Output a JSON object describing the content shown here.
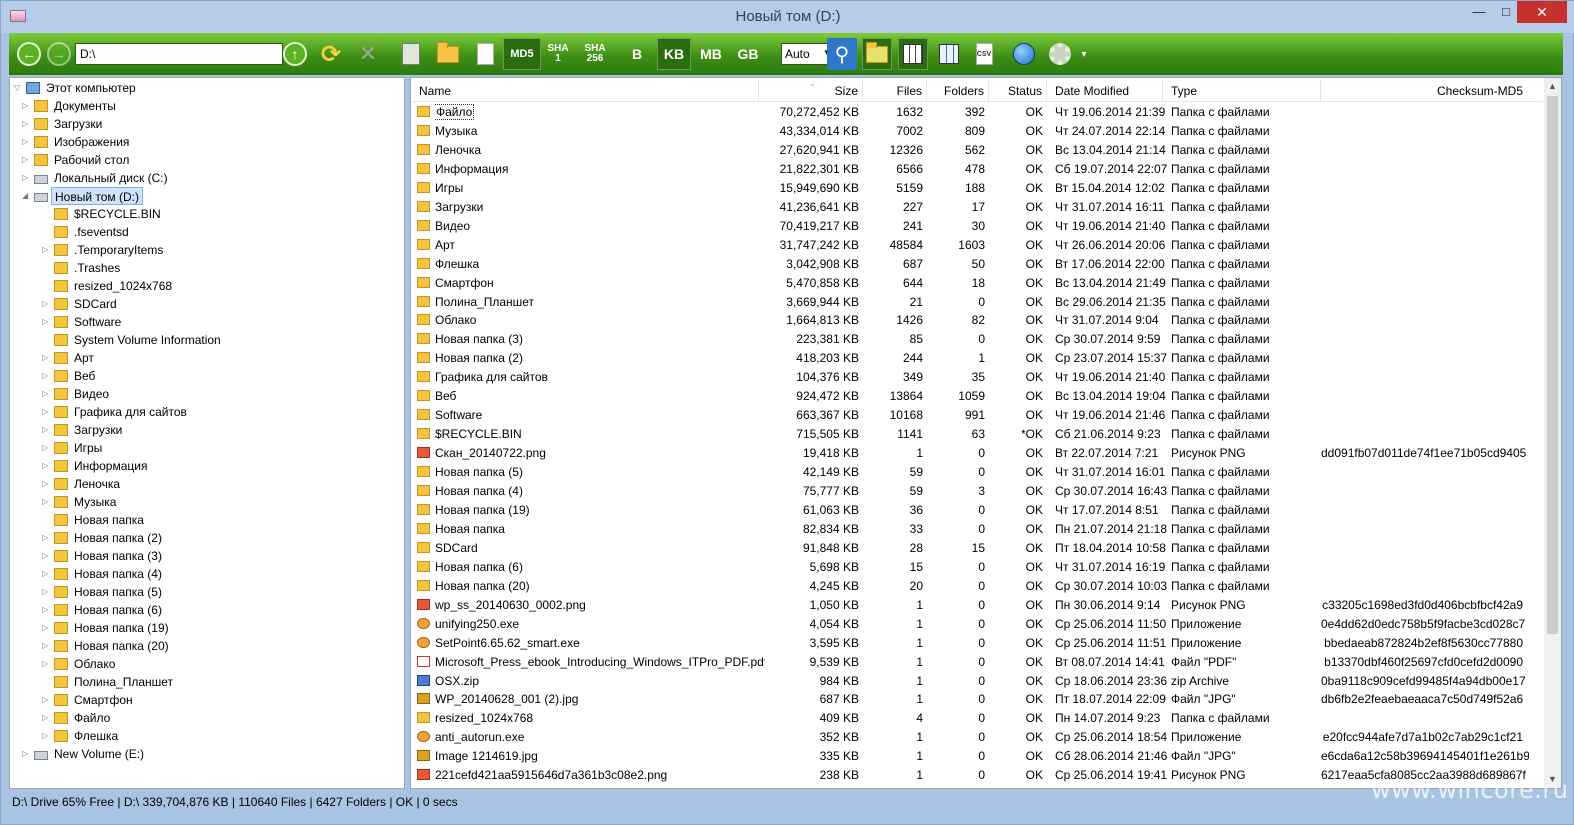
{
  "window": {
    "title": "Новый том (D:)",
    "minimize": "—",
    "maximize": "□",
    "close": "✕"
  },
  "toolbar": {
    "back": "←",
    "forward": "→",
    "path": "D:\\",
    "up": "↑",
    "refresh": "⟳",
    "stop": "✕",
    "md5": "MD5",
    "sha1": [
      "SHA",
      "1"
    ],
    "sha256": [
      "SHA",
      "256"
    ],
    "unit_b": "B",
    "unit_kb": "KB",
    "unit_mb": "MB",
    "unit_gb": "GB",
    "auto": "Auto",
    "csv": "CSV",
    "search": "⚲",
    "menu_arrow": "▾"
  },
  "tree": [
    {
      "label": "Этот компьютер",
      "level": 0,
      "expander": "▽",
      "icon": "pc"
    },
    {
      "label": "Документы",
      "level": 1,
      "expander": "▷",
      "icon": "folder"
    },
    {
      "label": "Загрузки",
      "level": 1,
      "expander": "▷",
      "icon": "folder"
    },
    {
      "label": "Изображения",
      "level": 1,
      "expander": "▷",
      "icon": "folder"
    },
    {
      "label": "Рабочий стол",
      "level": 1,
      "expander": "▷",
      "icon": "folder"
    },
    {
      "label": "Локальный диск (C:)",
      "level": 1,
      "expander": "▷",
      "icon": "drive"
    },
    {
      "label": "Новый том (D:)",
      "level": 1,
      "expander": "◢",
      "icon": "drive",
      "selected": true
    },
    {
      "label": "$RECYCLE.BIN",
      "level": 2,
      "expander": "",
      "icon": "folder"
    },
    {
      "label": ".fseventsd",
      "level": 2,
      "expander": "",
      "icon": "folder"
    },
    {
      "label": ".TemporaryItems",
      "level": 2,
      "expander": "▷",
      "icon": "folder"
    },
    {
      "label": ".Trashes",
      "level": 2,
      "expander": "",
      "icon": "folder"
    },
    {
      "label": "resized_1024x768",
      "level": 2,
      "expander": "",
      "icon": "folder"
    },
    {
      "label": "SDCard",
      "level": 2,
      "expander": "▷",
      "icon": "folder"
    },
    {
      "label": "Software",
      "level": 2,
      "expander": "▷",
      "icon": "folder"
    },
    {
      "label": "System Volume Information",
      "level": 2,
      "expander": "",
      "icon": "folder"
    },
    {
      "label": "Арт",
      "level": 2,
      "expander": "▷",
      "icon": "folder"
    },
    {
      "label": "Веб",
      "level": 2,
      "expander": "▷",
      "icon": "folder"
    },
    {
      "label": "Видео",
      "level": 2,
      "expander": "▷",
      "icon": "folder"
    },
    {
      "label": "Графика для сайтов",
      "level": 2,
      "expander": "▷",
      "icon": "folder"
    },
    {
      "label": "Загрузки",
      "level": 2,
      "expander": "▷",
      "icon": "folder"
    },
    {
      "label": "Игры",
      "level": 2,
      "expander": "▷",
      "icon": "folder"
    },
    {
      "label": "Информация",
      "level": 2,
      "expander": "▷",
      "icon": "folder"
    },
    {
      "label": "Леночка",
      "level": 2,
      "expander": "▷",
      "icon": "folder"
    },
    {
      "label": "Музыка",
      "level": 2,
      "expander": "▷",
      "icon": "folder"
    },
    {
      "label": "Новая папка",
      "level": 2,
      "expander": "",
      "icon": "folder"
    },
    {
      "label": "Новая папка (2)",
      "level": 2,
      "expander": "▷",
      "icon": "folder"
    },
    {
      "label": "Новая папка (3)",
      "level": 2,
      "expander": "▷",
      "icon": "folder"
    },
    {
      "label": "Новая папка (4)",
      "level": 2,
      "expander": "▷",
      "icon": "folder"
    },
    {
      "label": "Новая папка (5)",
      "level": 2,
      "expander": "▷",
      "icon": "folder"
    },
    {
      "label": "Новая папка (6)",
      "level": 2,
      "expander": "▷",
      "icon": "folder"
    },
    {
      "label": "Новая папка (19)",
      "level": 2,
      "expander": "▷",
      "icon": "folder"
    },
    {
      "label": "Новая папка (20)",
      "level": 2,
      "expander": "▷",
      "icon": "folder"
    },
    {
      "label": "Облако",
      "level": 2,
      "expander": "▷",
      "icon": "folder"
    },
    {
      "label": "Полина_Планшет",
      "level": 2,
      "expander": "",
      "icon": "folder"
    },
    {
      "label": "Смартфон",
      "level": 2,
      "expander": "▷",
      "icon": "folder"
    },
    {
      "label": "Файло",
      "level": 2,
      "expander": "▷",
      "icon": "folder"
    },
    {
      "label": "Флешка",
      "level": 2,
      "expander": "▷",
      "icon": "folder"
    },
    {
      "label": "New Volume (E:)",
      "level": 1,
      "expander": "▷",
      "icon": "drive"
    }
  ],
  "columns": {
    "name": "Name",
    "size": "Size",
    "files": "Files",
    "folders": "Folders",
    "status": "Status",
    "date": "Date Modified",
    "type": "Type",
    "checksum": "Checksum-MD5"
  },
  "files": [
    {
      "name": "Файло",
      "icon": "folder",
      "size": "70,272,452 KB",
      "files": "1632",
      "folders": "392",
      "status": "OK",
      "date": "Чт 19.06.2014 21:39",
      "type": "Папка с файлами",
      "md5": ""
    },
    {
      "name": "Музыка",
      "icon": "folder",
      "size": "43,334,014 KB",
      "files": "7002",
      "folders": "809",
      "status": "OK",
      "date": "Чт 24.07.2014 22:14",
      "type": "Папка с файлами",
      "md5": ""
    },
    {
      "name": "Леночка",
      "icon": "folder",
      "size": "27,620,941 KB",
      "files": "12326",
      "folders": "562",
      "status": "OK",
      "date": "Вс 13.04.2014 21:14",
      "type": "Папка с файлами",
      "md5": ""
    },
    {
      "name": "Информация",
      "icon": "folder",
      "size": "21,822,301 KB",
      "files": "6566",
      "folders": "478",
      "status": "OK",
      "date": "Сб 19.07.2014 22:07",
      "type": "Папка с файлами",
      "md5": ""
    },
    {
      "name": "Игры",
      "icon": "folder",
      "size": "15,949,690 KB",
      "files": "5159",
      "folders": "188",
      "status": "OK",
      "date": "Вт 15.04.2014 12:02",
      "type": "Папка с файлами",
      "md5": ""
    },
    {
      "name": "Загрузки",
      "icon": "folder",
      "size": "41,236,641 KB",
      "files": "227",
      "folders": "17",
      "status": "OK",
      "date": "Чт 31.07.2014 16:11",
      "type": "Папка с файлами",
      "md5": ""
    },
    {
      "name": "Видео",
      "icon": "folder",
      "size": "70,419,217 KB",
      "files": "241",
      "folders": "30",
      "status": "OK",
      "date": "Чт 19.06.2014 21:40",
      "type": "Папка с файлами",
      "md5": ""
    },
    {
      "name": "Арт",
      "icon": "folder",
      "size": "31,747,242 KB",
      "files": "48584",
      "folders": "1603",
      "status": "OK",
      "date": "Чт 26.06.2014 20:06",
      "type": "Папка с файлами",
      "md5": ""
    },
    {
      "name": "Флешка",
      "icon": "folder",
      "size": "3,042,908 KB",
      "files": "687",
      "folders": "50",
      "status": "OK",
      "date": "Вт 17.06.2014 22:00",
      "type": "Папка с файлами",
      "md5": ""
    },
    {
      "name": "Смартфон",
      "icon": "folder",
      "size": "5,470,858 KB",
      "files": "644",
      "folders": "18",
      "status": "OK",
      "date": "Вс 13.04.2014 21:49",
      "type": "Папка с файлами",
      "md5": ""
    },
    {
      "name": "Полина_Планшет",
      "icon": "folder",
      "size": "3,669,944 KB",
      "files": "21",
      "folders": "0",
      "status": "OK",
      "date": "Вс 29.06.2014 21:35",
      "type": "Папка с файлами",
      "md5": ""
    },
    {
      "name": "Облако",
      "icon": "folder",
      "size": "1,664,813 KB",
      "files": "1426",
      "folders": "82",
      "status": "OK",
      "date": "Чт 31.07.2014 9:04",
      "type": "Папка с файлами",
      "md5": ""
    },
    {
      "name": "Новая папка (3)",
      "icon": "folder",
      "size": "223,381 KB",
      "files": "85",
      "folders": "0",
      "status": "OK",
      "date": "Ср 30.07.2014 9:59",
      "type": "Папка с файлами",
      "md5": ""
    },
    {
      "name": "Новая папка (2)",
      "icon": "folder",
      "size": "418,203 KB",
      "files": "244",
      "folders": "1",
      "status": "OK",
      "date": "Ср 23.07.2014 15:37",
      "type": "Папка с файлами",
      "md5": ""
    },
    {
      "name": "Графика для сайтов",
      "icon": "folder",
      "size": "104,376 KB",
      "files": "349",
      "folders": "35",
      "status": "OK",
      "date": "Чт 19.06.2014 21:40",
      "type": "Папка с файлами",
      "md5": ""
    },
    {
      "name": "Веб",
      "icon": "folder",
      "size": "924,472 KB",
      "files": "13864",
      "folders": "1059",
      "status": "OK",
      "date": "Вс 13.04.2014 19:04",
      "type": "Папка с файлами",
      "md5": ""
    },
    {
      "name": "Software",
      "icon": "folder",
      "size": "663,367 KB",
      "files": "10168",
      "folders": "991",
      "status": "OK",
      "date": "Чт 19.06.2014 21:46",
      "type": "Папка с файлами",
      "md5": ""
    },
    {
      "name": "$RECYCLE.BIN",
      "icon": "folder",
      "size": "715,505 KB",
      "files": "1141",
      "folders": "63",
      "status": "*OK",
      "date": "Сб 21.06.2014 9:23",
      "type": "Папка с файлами",
      "md5": ""
    },
    {
      "name": "Скан_20140722.png",
      "icon": "png",
      "size": "19,418 KB",
      "files": "1",
      "folders": "0",
      "status": "OK",
      "date": "Вт 22.07.2014 7:21",
      "type": "Рисунок PNG",
      "md5": "dd091fb07d011de74f1ee71b05cd9405"
    },
    {
      "name": "Новая папка (5)",
      "icon": "folder",
      "size": "42,149 KB",
      "files": "59",
      "folders": "0",
      "status": "OK",
      "date": "Чт 31.07.2014 16:01",
      "type": "Папка с файлами",
      "md5": ""
    },
    {
      "name": "Новая папка (4)",
      "icon": "folder",
      "size": "75,777 KB",
      "files": "59",
      "folders": "3",
      "status": "OK",
      "date": "Ср 30.07.2014 16:43",
      "type": "Папка с файлами",
      "md5": ""
    },
    {
      "name": "Новая папка (19)",
      "icon": "folder",
      "size": "61,063 KB",
      "files": "36",
      "folders": "0",
      "status": "OK",
      "date": "Чт 17.07.2014 8:51",
      "type": "Папка с файлами",
      "md5": ""
    },
    {
      "name": "Новая папка",
      "icon": "folder",
      "size": "82,834 KB",
      "files": "33",
      "folders": "0",
      "status": "OK",
      "date": "Пн 21.07.2014 21:18",
      "type": "Папка с файлами",
      "md5": ""
    },
    {
      "name": "SDCard",
      "icon": "folder",
      "size": "91,848 KB",
      "files": "28",
      "folders": "15",
      "status": "OK",
      "date": "Пт 18.04.2014 10:58",
      "type": "Папка с файлами",
      "md5": ""
    },
    {
      "name": "Новая папка (6)",
      "icon": "folder",
      "size": "5,698 KB",
      "files": "15",
      "folders": "0",
      "status": "OK",
      "date": "Чт 31.07.2014 16:19",
      "type": "Папка с файлами",
      "md5": ""
    },
    {
      "name": "Новая папка (20)",
      "icon": "folder",
      "size": "4,245 KB",
      "files": "20",
      "folders": "0",
      "status": "OK",
      "date": "Ср 30.07.2014 10:03",
      "type": "Папка с файлами",
      "md5": ""
    },
    {
      "name": "wp_ss_20140630_0002.png",
      "icon": "png",
      "size": "1,050 KB",
      "files": "1",
      "folders": "0",
      "status": "OK",
      "date": "Пн 30.06.2014 9:14",
      "type": "Рисунок PNG",
      "md5": "c33205c1698ed3fd0d406bcbfbcf42a9"
    },
    {
      "name": "unifying250.exe",
      "icon": "exe",
      "size": "4,054 KB",
      "files": "1",
      "folders": "0",
      "status": "OK",
      "date": "Ср 25.06.2014 11:50",
      "type": "Приложение",
      "md5": "0e4dd62d0edc758b5f9facbe3cd028c7"
    },
    {
      "name": "SetPoint6.65.62_smart.exe",
      "icon": "exe",
      "size": "3,595 KB",
      "files": "1",
      "folders": "0",
      "status": "OK",
      "date": "Ср 25.06.2014 11:51",
      "type": "Приложение",
      "md5": "bbedaeab872824b2ef8f5630cc77880"
    },
    {
      "name": "Microsoft_Press_ebook_Introducing_Windows_ITPro_PDF.pdf",
      "icon": "pdf",
      "size": "9,539 KB",
      "files": "1",
      "folders": "0",
      "status": "OK",
      "date": "Вт 08.07.2014 14:41",
      "type": "Файл \"PDF\"",
      "md5": "b13370dbf460f25697cfd0cefd2d0090"
    },
    {
      "name": "OSX.zip",
      "icon": "zip",
      "size": "984 KB",
      "files": "1",
      "folders": "0",
      "status": "OK",
      "date": "Ср 18.06.2014 23:36",
      "type": "zip Archive",
      "md5": "0ba9118c909cefd99485f4a94db00e17"
    },
    {
      "name": "WP_20140628_001 (2).jpg",
      "icon": "jpg",
      "size": "687 KB",
      "files": "1",
      "folders": "0",
      "status": "OK",
      "date": "Пт 18.07.2014 22:09",
      "type": "Файл \"JPG\"",
      "md5": "db6fb2e2feaebaeaaca7c50d749f52a6"
    },
    {
      "name": "resized_1024x768",
      "icon": "folder",
      "size": "409 KB",
      "files": "4",
      "folders": "0",
      "status": "OK",
      "date": "Пн 14.07.2014 9:23",
      "type": "Папка с файлами",
      "md5": ""
    },
    {
      "name": "anti_autorun.exe",
      "icon": "exe",
      "size": "352 KB",
      "files": "1",
      "folders": "0",
      "status": "OK",
      "date": "Ср 25.06.2014 18:54",
      "type": "Приложение",
      "md5": "e20fcc944afe7d7a1b02c7ab29c1cf21"
    },
    {
      "name": "Image 1214619.jpg",
      "icon": "jpg",
      "size": "335 KB",
      "files": "1",
      "folders": "0",
      "status": "OK",
      "date": "Сб 28.06.2014 21:46",
      "type": "Файл \"JPG\"",
      "md5": "e6cda6a12c58b39694145401f1e261b9"
    },
    {
      "name": "221cefd421aa5915646d7a361b3c08e2.png",
      "icon": "png",
      "size": "238 KB",
      "files": "1",
      "folders": "0",
      "status": "OK",
      "date": "Ср 25.06.2014 19:41",
      "type": "Рисунок PNG",
      "md5": "6217eaa5cfa8085cc2aa3988d689867f"
    }
  ],
  "status": {
    "text": "D:\\ Drive 65% Free |  D:\\ 339,704,876  KB  |  110640 Files  |  6427 Folders  |  OK  |  0 secs"
  },
  "watermark": "www.wincore.ru"
}
